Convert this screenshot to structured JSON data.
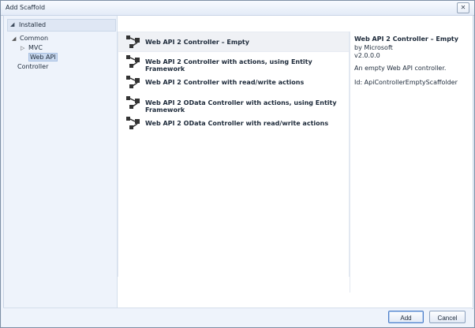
{
  "window": {
    "title": "Add Scaffold",
    "close_glyph": "✕"
  },
  "left": {
    "installed_label": "Installed",
    "tree": [
      {
        "label": "Common",
        "arrow": "◢"
      },
      {
        "label": "MVC",
        "arrow": "▷"
      },
      {
        "label": "Web API",
        "arrow": ""
      },
      {
        "label": "Controller",
        "arrow": ""
      }
    ]
  },
  "list": {
    "items": [
      {
        "label": "Web API 2 Controller – Empty",
        "icon": "controller-scaffold-icon"
      },
      {
        "label": "Web API 2 Controller with actions, using Entity Framework",
        "icon": "controller-scaffold-icon"
      },
      {
        "label": "Web API 2 Controller with read/write actions",
        "icon": "controller-scaffold-icon"
      },
      {
        "label": "Web API 2 OData Controller with actions, using Entity Framework",
        "icon": "controller-scaffold-icon"
      },
      {
        "label": "Web API 2 OData Controller with read/write actions",
        "icon": "controller-scaffold-icon"
      }
    ]
  },
  "details": {
    "title": "Web API 2 Controller – Empty",
    "by": "by Microsoft",
    "version": "v2.0.0.0",
    "description": "An empty Web API controller.",
    "id": "Id: ApiControllerEmptyScaffolder"
  },
  "footer": {
    "add_label": "Add",
    "cancel_label": "Cancel"
  },
  "colors": {
    "selection": "#c9d9ef",
    "accent": "#4a7cc7"
  }
}
